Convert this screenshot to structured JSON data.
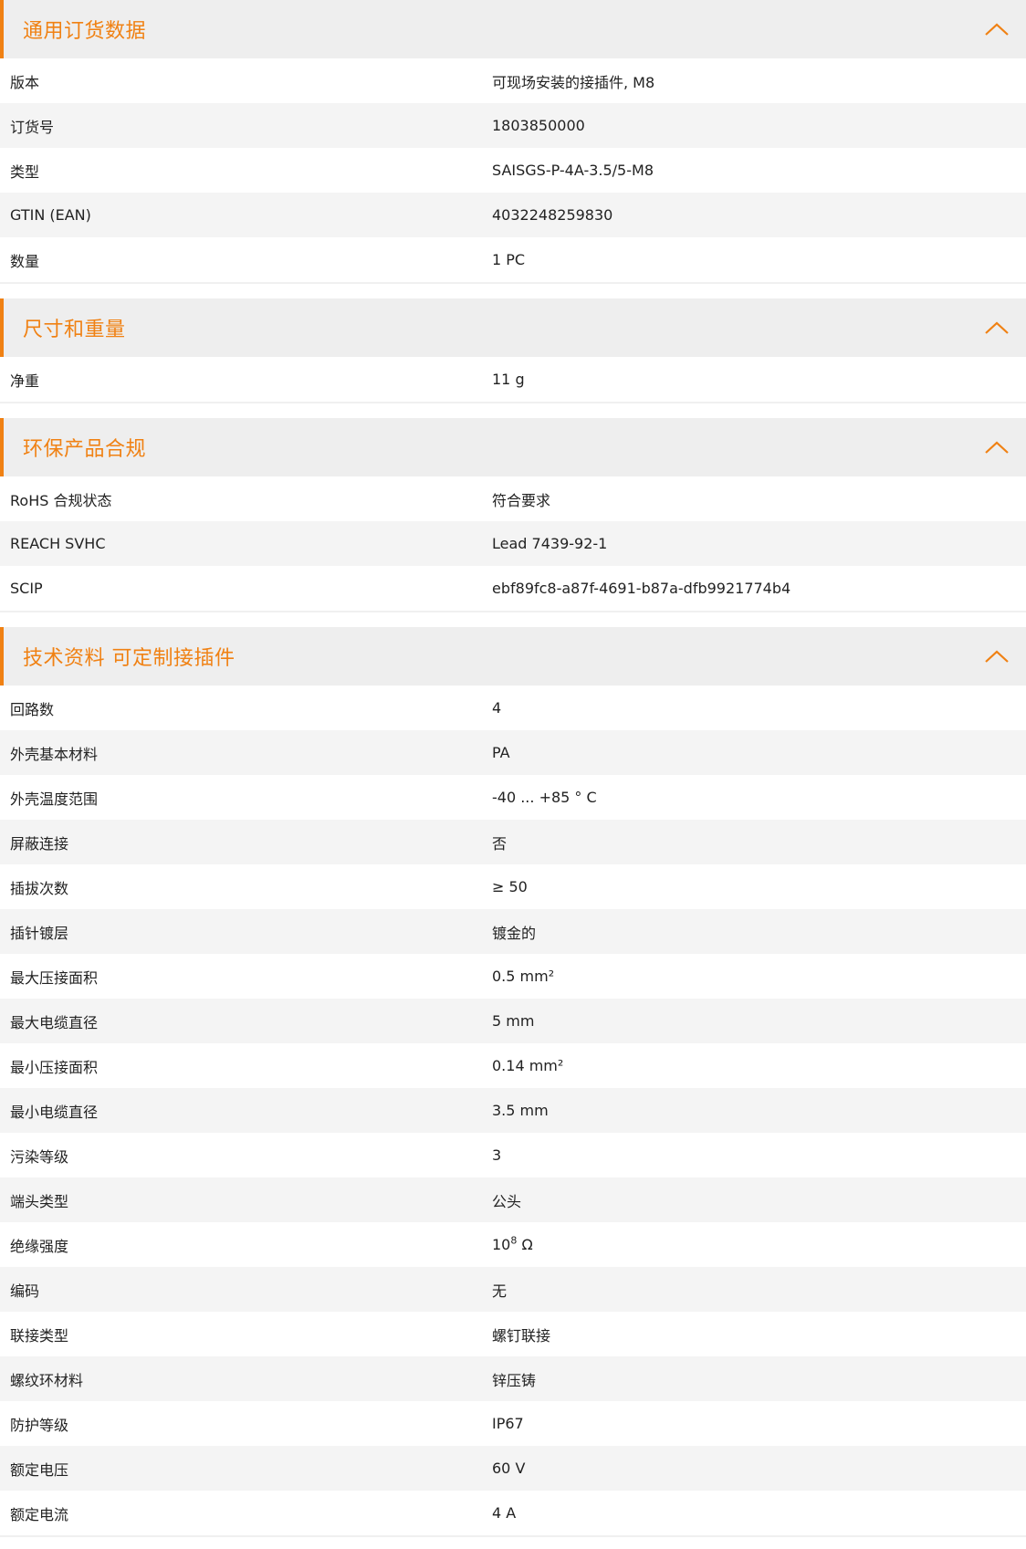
{
  "theme": {
    "accent": "#f08113",
    "header_bg": "#eeeeee",
    "row_alt_bg": "#f4f4f4",
    "icon": "chevron-up-icon"
  },
  "sections": [
    {
      "title": "通用订货数据",
      "rows": [
        {
          "label": "版本",
          "value": "可现场安装的接插件, M8"
        },
        {
          "label": "订货号",
          "value": "1803850000"
        },
        {
          "label": "类型",
          "value": "SAISGS-P-4A-3.5/5-M8"
        },
        {
          "label": "GTIN (EAN)",
          "value": "4032248259830"
        },
        {
          "label": "数量",
          "value": "1  PC"
        }
      ]
    },
    {
      "title": "尺寸和重量",
      "rows": [
        {
          "label": "净重",
          "value": "11  g"
        }
      ]
    },
    {
      "title": "环保产品合规",
      "rows": [
        {
          "label": "RoHS 合规状态",
          "value": "符合要求"
        },
        {
          "label": "REACH SVHC",
          "value": "Lead 7439-92-1"
        },
        {
          "label": "SCIP",
          "value": "ebf89fc8-a87f-4691-b87a-dfb9921774b4"
        }
      ]
    },
    {
      "title": "技术资料 可定制接插件",
      "rows": [
        {
          "label": "回路数",
          "value": "4"
        },
        {
          "label": "外壳基本材料",
          "value": "PA"
        },
        {
          "label": "外壳温度范围",
          "value": "-40 ... +85 ° C"
        },
        {
          "label": "屏蔽连接",
          "value": "否"
        },
        {
          "label": "插拔次数",
          "value": "≥ 50"
        },
        {
          "label": "插针镀层",
          "value": "镀金的"
        },
        {
          "label": "最大压接面积",
          "value": "0.5  mm²"
        },
        {
          "label": "最大电缆直径",
          "value": "5  mm"
        },
        {
          "label": "最小压接面积",
          "value": "0.14  mm²"
        },
        {
          "label": "最小电缆直径",
          "value": "3.5  mm"
        },
        {
          "label": "污染等级",
          "value": "3"
        },
        {
          "label": "端头类型",
          "value": "公头"
        },
        {
          "label": "绝缘强度",
          "value": "10",
          "sup": "8",
          "suffix": " Ω"
        },
        {
          "label": "编码",
          "value": "无"
        },
        {
          "label": "联接类型",
          "value": "螺钉联接"
        },
        {
          "label": "螺纹环材料",
          "value": "锌压铸"
        },
        {
          "label": "防护等级",
          "value": "IP67"
        },
        {
          "label": "额定电压",
          "value": "60  V"
        },
        {
          "label": "额定电流",
          "value": "4  A"
        }
      ]
    }
  ]
}
